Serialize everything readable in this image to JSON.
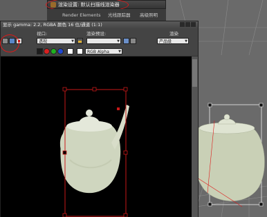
{
  "render_setup": {
    "title": "渲染设置: 默认扫描线渲染器",
    "tabs": [
      "Render Elements",
      "光线跟踪器",
      "高级照明"
    ]
  },
  "frame_window": {
    "title": "显示 gamma: 2.2, RGBA 颜色 16 位/通道 (1:1)",
    "labels": {
      "viewport": "视口:",
      "preset": "渲染预设:",
      "render": "渲染"
    },
    "viewport_value": "透视",
    "preset_value": "",
    "render_value": "产品级",
    "channel_value": "RGB Alpha"
  },
  "colors": {
    "accent_red": "#e01818",
    "canvas_bg": "#000000",
    "teapot": "#cfd6bf"
  },
  "icons": [
    "app-icon",
    "save-icon",
    "copy-icon",
    "clone-icon",
    "red-channel-icon",
    "green-channel-icon",
    "blue-channel-icon",
    "lock-icon",
    "render-icon"
  ]
}
